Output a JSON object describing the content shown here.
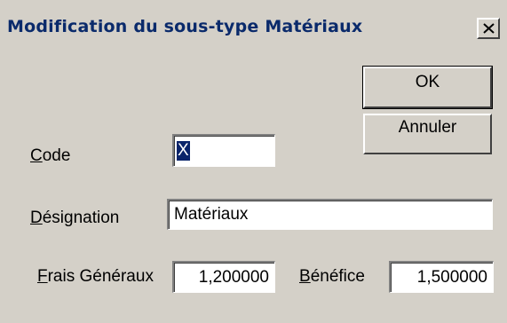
{
  "window": {
    "title": "Modification du sous-type Matériaux",
    "close_icon": "close-icon"
  },
  "buttons": {
    "ok_label": "OK",
    "cancel_label": "Annuler"
  },
  "fields": {
    "code": {
      "label_accel": "C",
      "label_rest": "ode",
      "value": "X"
    },
    "designation": {
      "label_accel": "D",
      "label_rest": "ésignation",
      "value": "Matériaux"
    },
    "frais_generaux": {
      "label_accel": "F",
      "label_rest": "rais Généraux",
      "value": "1,200000"
    },
    "benefice": {
      "label_accel": "B",
      "label_rest": "énéfice",
      "value": "1,500000"
    }
  },
  "colors": {
    "face": "#d4d0c8",
    "title_text": "#0a2a6b",
    "selection": "#0a246a"
  }
}
